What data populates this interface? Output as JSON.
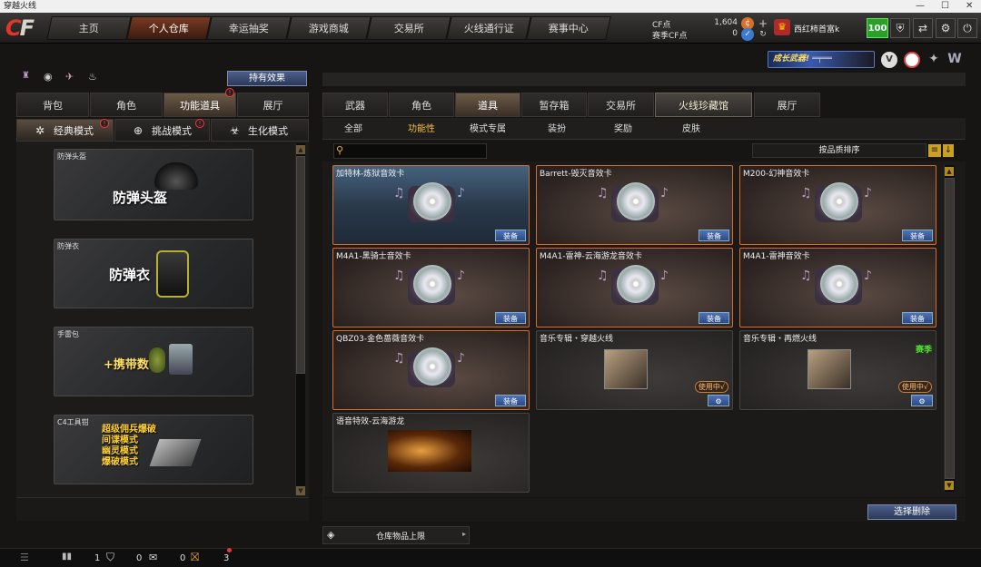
{
  "window": {
    "title": "穿越火线"
  },
  "nav": {
    "tabs": [
      "主页",
      "个人仓库",
      "幸运抽奖",
      "游戏商城",
      "交易所",
      "火线通行证",
      "赛事中心"
    ],
    "active": "个人仓库"
  },
  "account": {
    "cf_label": "CF点",
    "cf_value": "1,604",
    "season_label": "赛季CF点",
    "season_value": "0",
    "nickname": "西红柿首富k",
    "level": "100"
  },
  "banner": {
    "text": "成长武器!"
  },
  "left": {
    "hold_effect_button": "持有效果",
    "tabs": [
      "背包",
      "角色",
      "功能道具",
      "展厅"
    ],
    "active_tab": "功能道具",
    "modes": [
      "经典模式",
      "挑战模式",
      "生化模式"
    ],
    "active_mode": "经典模式",
    "cards": [
      {
        "caption": "防弹头盔",
        "title": "防弹头盔"
      },
      {
        "caption": "防弹衣",
        "title": "防弹衣"
      },
      {
        "caption": "手雷包",
        "title": "+携带数"
      },
      {
        "caption": "C4工具钳",
        "lines": [
          "超级佣兵爆破",
          "间谍模式",
          "幽灵模式",
          "爆破模式"
        ]
      }
    ]
  },
  "right": {
    "tabs": [
      "武器",
      "角色",
      "道具",
      "暂存箱",
      "交易所",
      "火线珍藏馆",
      "展厅"
    ],
    "active_tab": "道具",
    "highlight_tab": "火线珍藏馆",
    "subtabs": [
      "全部",
      "功能性",
      "模式专属",
      "装扮",
      "奖励",
      "皮肤"
    ],
    "active_subtab": "功能性",
    "search_placeholder": "",
    "sort_label": "按品质排序",
    "items": [
      {
        "name": "加特林-炼狱音效卡",
        "button": "装备"
      },
      {
        "name": "Barrett-毁灭音效卡",
        "button": "装备"
      },
      {
        "name": "M200-幻神音效卡",
        "button": "装备"
      },
      {
        "name": "M4A1-黑骑士音效卡",
        "button": "装备"
      },
      {
        "name": "M4A1-雷神-云海游龙音效卡",
        "button": "装备"
      },
      {
        "name": "M4A1-雷神音效卡",
        "button": "装备"
      },
      {
        "name": "QBZ03-金色蔷薇音效卡",
        "button": "装备"
      },
      {
        "name": "音乐专辑・穿越火线",
        "status": "使用中√"
      },
      {
        "name": "音乐专辑・再燃火线",
        "status": "使用中√",
        "tag": "赛季"
      },
      {
        "name": "语音特效-云海游龙"
      }
    ],
    "delete_button": "选择删除",
    "capacity_label": "仓库物品上限"
  },
  "bottom": {
    "friends_count": "1",
    "chat_count": "0",
    "gift_count": "0",
    "notify_count": "3"
  }
}
